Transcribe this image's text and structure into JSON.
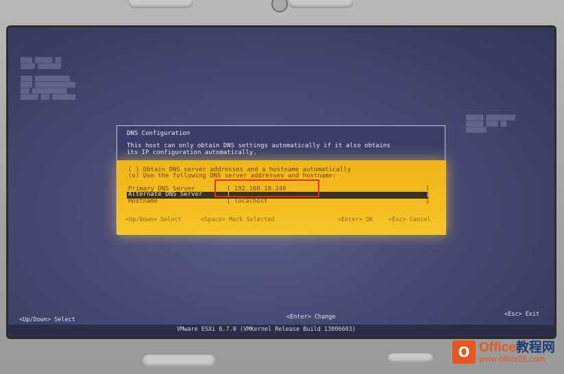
{
  "dialog": {
    "title": "DNS Configuration",
    "message": "This host can only obtain DNS settings automatically if it also obtains\nits IP configuration automatically.",
    "options": [
      "( ) Obtain DNS server addresses and a hostname automatically",
      "(o) Use the following DNS server addresses and hostname:"
    ],
    "fields": [
      {
        "label": "Primary DNS Server",
        "value": "[ 192.168.10.248"
      },
      {
        "label": "Alternate DNS Server",
        "value": "["
      },
      {
        "label": "Hostname",
        "value": "[ localhost"
      }
    ],
    "hints": {
      "up_down": "<Up/Down> Select",
      "space": "<Space> Mark Selected",
      "enter": "<Enter> OK",
      "esc": "<Esc> Cancel"
    }
  },
  "footer": {
    "left": "<Up/Down> Select",
    "center": "<Enter> Change",
    "right": "<Esc> Exit",
    "product": "VMware ESXi 6.7.0 (VMKernel Release Build 13006603)"
  },
  "watermark": {
    "brand": "Office",
    "brand_suffix": "教程网",
    "url": "www.office26.com"
  },
  "colors": {
    "panel": "#f4bd20",
    "screen": "#4a4e78",
    "highlight": "#e0301e"
  }
}
